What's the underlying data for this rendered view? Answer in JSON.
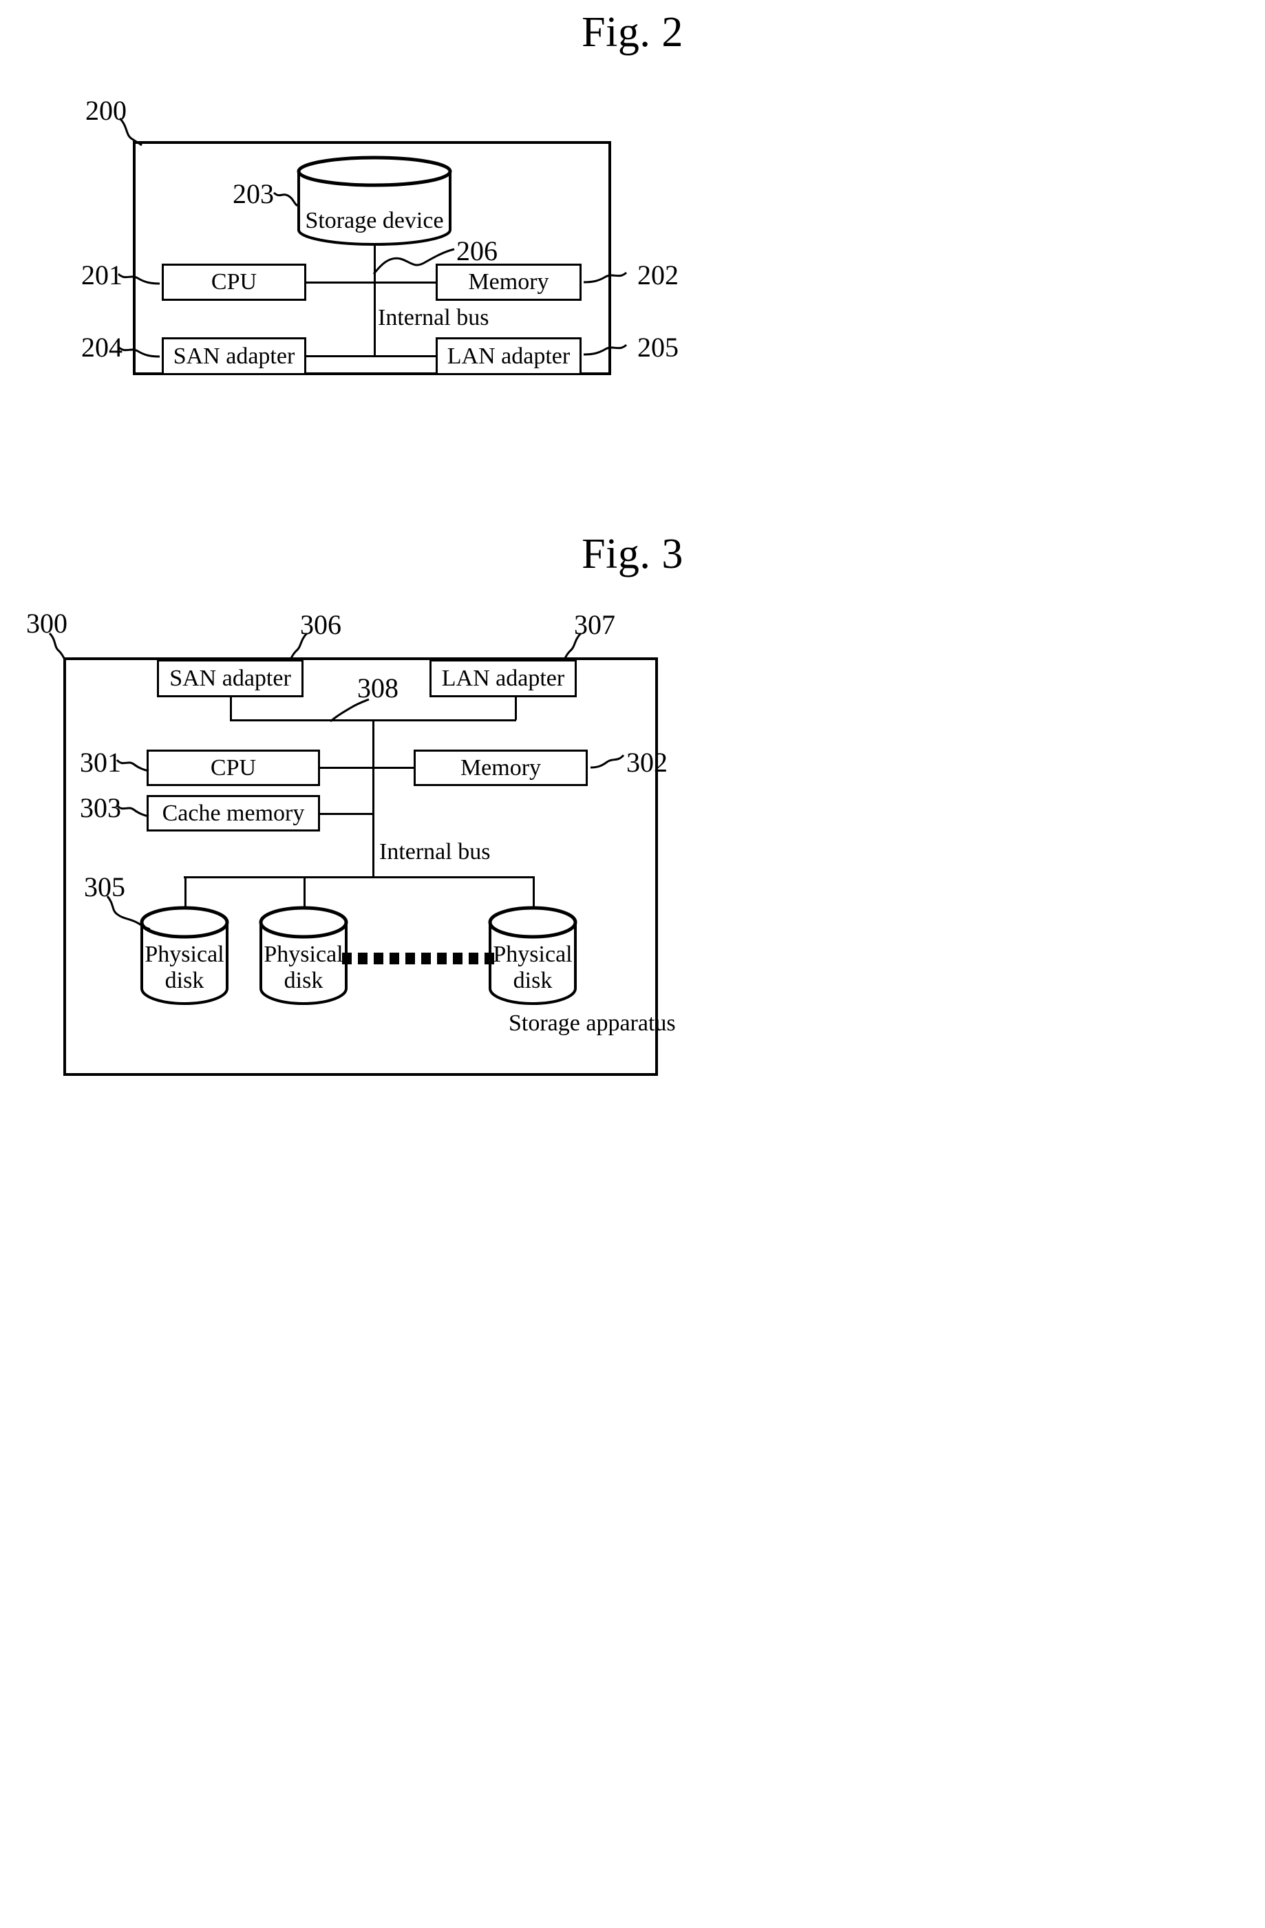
{
  "figures": [
    {
      "id": "fig2",
      "title": "Fig. 2",
      "outer_ref": "200",
      "internal_bus_label": "Internal bus",
      "bus_ref": "206",
      "storage_device": {
        "label": "Storage device",
        "ref": "203"
      },
      "blocks": [
        {
          "key": "cpu",
          "label": "CPU",
          "ref": "201"
        },
        {
          "key": "memory",
          "label": "Memory",
          "ref": "202"
        },
        {
          "key": "san_adapter",
          "label": "SAN adapter",
          "ref": "204"
        },
        {
          "key": "lan_adapter",
          "label": "LAN adapter",
          "ref": "205"
        }
      ]
    },
    {
      "id": "fig3",
      "title": "Fig. 3",
      "outer_ref": "300",
      "outer_label": "Storage apparatus",
      "internal_bus_label": "Internal bus",
      "bus_ref": "308",
      "blocks": [
        {
          "key": "san_adapter",
          "label": "SAN adapter",
          "ref": "306"
        },
        {
          "key": "lan_adapter",
          "label": "LAN adapter",
          "ref": "307"
        },
        {
          "key": "cpu",
          "label": "CPU",
          "ref": "301"
        },
        {
          "key": "memory",
          "label": "Memory",
          "ref": "302"
        },
        {
          "key": "cache_memory",
          "label": "Cache memory",
          "ref": "303"
        }
      ],
      "physical_disks": {
        "ref": "305",
        "label": "Physical\ndisk",
        "count_shown": 3,
        "ellipsis_glyph": "▪▪▪▪▪▪▪▪▪▪"
      }
    }
  ]
}
